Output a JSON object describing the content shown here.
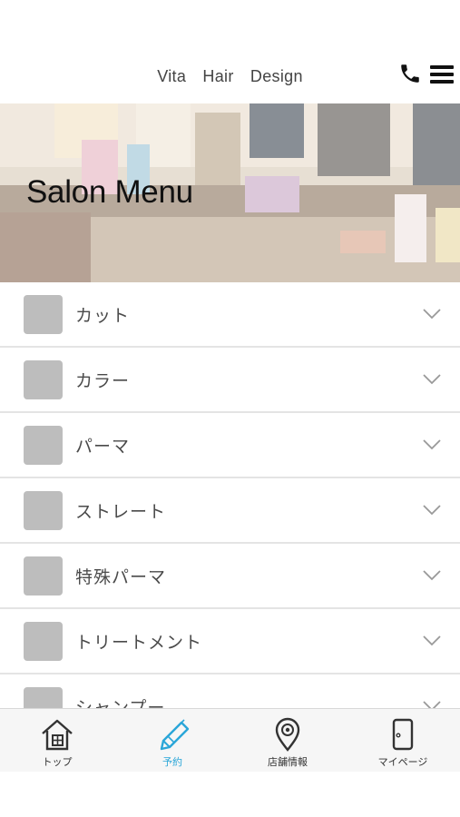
{
  "header": {
    "brand": "Vita　Hair　Design",
    "phone_icon": "phone-icon",
    "menu_icon": "hamburger-menu-icon"
  },
  "hero": {
    "title": "Salon Menu"
  },
  "menu": {
    "items": [
      {
        "label": "カット"
      },
      {
        "label": "カラー"
      },
      {
        "label": "パーマ"
      },
      {
        "label": "ストレート"
      },
      {
        "label": "特殊パーマ"
      },
      {
        "label": "トリートメント"
      },
      {
        "label": "シャンプー"
      }
    ]
  },
  "tabbar": {
    "active_color": "#2aa6d8",
    "tabs": [
      {
        "label": "トップ",
        "icon": "home-icon"
      },
      {
        "label": "予約",
        "icon": "pencil-icon",
        "active": true
      },
      {
        "label": "店舗情報",
        "icon": "map-pin-icon"
      },
      {
        "label": "マイページ",
        "icon": "door-icon"
      }
    ]
  }
}
